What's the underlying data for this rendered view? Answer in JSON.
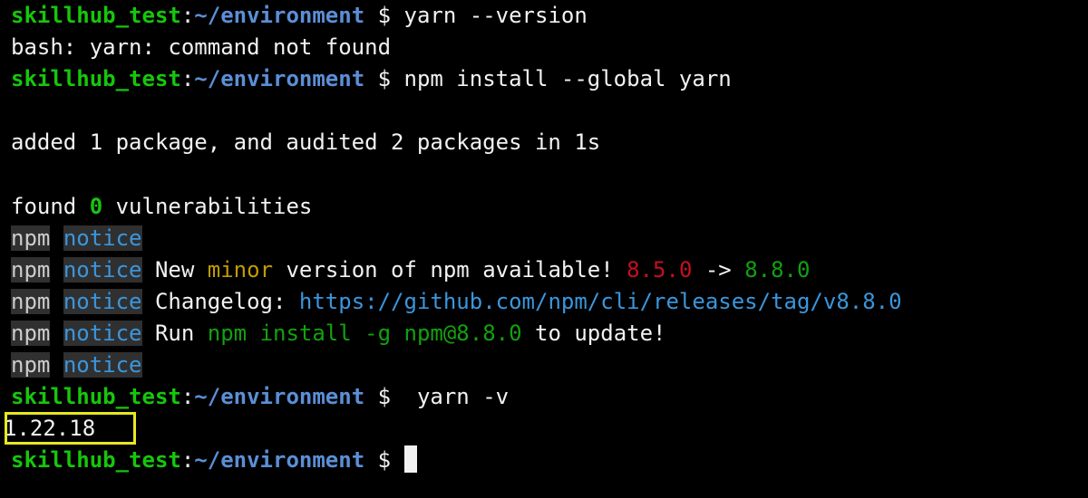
{
  "prompt": {
    "user": "skillhub_test",
    "separator": ":",
    "path": "~/environment",
    "symbol": "$"
  },
  "lines": {
    "cmd1": " yarn --version",
    "out1": "bash: yarn: command not found",
    "cmd2": " npm install --global yarn",
    "out2": "added 1 package, and audited 2 packages in 1s",
    "found_prefix": "found ",
    "found_count": "0",
    "found_suffix": " vulnerabilities",
    "cmd3": "  yarn -v",
    "version_output": "1.22.18"
  },
  "npm_notices": {
    "npm_label": "npm",
    "notice_label": "notice",
    "line2": {
      "text_a": " New ",
      "minor": "minor",
      "text_b": " version of npm available! ",
      "old_version": "8.5.0",
      "arrow": " -> ",
      "new_version": "8.8.0"
    },
    "line3": {
      "text_a": " Changelog: ",
      "url": "https://github.com/npm/cli/releases/tag/v8.8.0"
    },
    "line4": {
      "text_a": " Run ",
      "command": "npm install -g npm@8.8.0",
      "text_b": " to update!"
    }
  },
  "colors": {
    "background": "#000000",
    "prompt_user": "#16c60c",
    "prompt_path": "#5b8fd6",
    "highlight_box": "#e8e81f",
    "version_old": "#c50f1f",
    "version_new": "#13a10e",
    "link": "#3a96dd",
    "minor": "#c19c00"
  }
}
